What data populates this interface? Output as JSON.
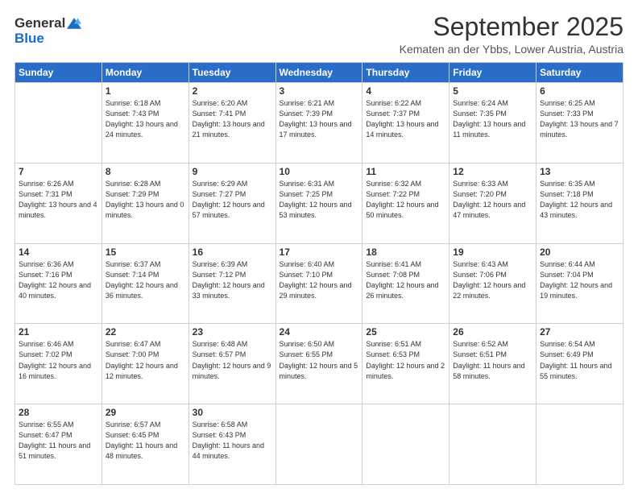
{
  "header": {
    "logo_general": "General",
    "logo_blue": "Blue",
    "month": "September 2025",
    "location": "Kematen an der Ybbs, Lower Austria, Austria"
  },
  "weekdays": [
    "Sunday",
    "Monday",
    "Tuesday",
    "Wednesday",
    "Thursday",
    "Friday",
    "Saturday"
  ],
  "weeks": [
    [
      {
        "day": "",
        "sunrise": "",
        "sunset": "",
        "daylight": ""
      },
      {
        "day": "1",
        "sunrise": "Sunrise: 6:18 AM",
        "sunset": "Sunset: 7:43 PM",
        "daylight": "Daylight: 13 hours and 24 minutes."
      },
      {
        "day": "2",
        "sunrise": "Sunrise: 6:20 AM",
        "sunset": "Sunset: 7:41 PM",
        "daylight": "Daylight: 13 hours and 21 minutes."
      },
      {
        "day": "3",
        "sunrise": "Sunrise: 6:21 AM",
        "sunset": "Sunset: 7:39 PM",
        "daylight": "Daylight: 13 hours and 17 minutes."
      },
      {
        "day": "4",
        "sunrise": "Sunrise: 6:22 AM",
        "sunset": "Sunset: 7:37 PM",
        "daylight": "Daylight: 13 hours and 14 minutes."
      },
      {
        "day": "5",
        "sunrise": "Sunrise: 6:24 AM",
        "sunset": "Sunset: 7:35 PM",
        "daylight": "Daylight: 13 hours and 11 minutes."
      },
      {
        "day": "6",
        "sunrise": "Sunrise: 6:25 AM",
        "sunset": "Sunset: 7:33 PM",
        "daylight": "Daylight: 13 hours and 7 minutes."
      }
    ],
    [
      {
        "day": "7",
        "sunrise": "Sunrise: 6:26 AM",
        "sunset": "Sunset: 7:31 PM",
        "daylight": "Daylight: 13 hours and 4 minutes."
      },
      {
        "day": "8",
        "sunrise": "Sunrise: 6:28 AM",
        "sunset": "Sunset: 7:29 PM",
        "daylight": "Daylight: 13 hours and 0 minutes."
      },
      {
        "day": "9",
        "sunrise": "Sunrise: 6:29 AM",
        "sunset": "Sunset: 7:27 PM",
        "daylight": "Daylight: 12 hours and 57 minutes."
      },
      {
        "day": "10",
        "sunrise": "Sunrise: 6:31 AM",
        "sunset": "Sunset: 7:25 PM",
        "daylight": "Daylight: 12 hours and 53 minutes."
      },
      {
        "day": "11",
        "sunrise": "Sunrise: 6:32 AM",
        "sunset": "Sunset: 7:22 PM",
        "daylight": "Daylight: 12 hours and 50 minutes."
      },
      {
        "day": "12",
        "sunrise": "Sunrise: 6:33 AM",
        "sunset": "Sunset: 7:20 PM",
        "daylight": "Daylight: 12 hours and 47 minutes."
      },
      {
        "day": "13",
        "sunrise": "Sunrise: 6:35 AM",
        "sunset": "Sunset: 7:18 PM",
        "daylight": "Daylight: 12 hours and 43 minutes."
      }
    ],
    [
      {
        "day": "14",
        "sunrise": "Sunrise: 6:36 AM",
        "sunset": "Sunset: 7:16 PM",
        "daylight": "Daylight: 12 hours and 40 minutes."
      },
      {
        "day": "15",
        "sunrise": "Sunrise: 6:37 AM",
        "sunset": "Sunset: 7:14 PM",
        "daylight": "Daylight: 12 hours and 36 minutes."
      },
      {
        "day": "16",
        "sunrise": "Sunrise: 6:39 AM",
        "sunset": "Sunset: 7:12 PM",
        "daylight": "Daylight: 12 hours and 33 minutes."
      },
      {
        "day": "17",
        "sunrise": "Sunrise: 6:40 AM",
        "sunset": "Sunset: 7:10 PM",
        "daylight": "Daylight: 12 hours and 29 minutes."
      },
      {
        "day": "18",
        "sunrise": "Sunrise: 6:41 AM",
        "sunset": "Sunset: 7:08 PM",
        "daylight": "Daylight: 12 hours and 26 minutes."
      },
      {
        "day": "19",
        "sunrise": "Sunrise: 6:43 AM",
        "sunset": "Sunset: 7:06 PM",
        "daylight": "Daylight: 12 hours and 22 minutes."
      },
      {
        "day": "20",
        "sunrise": "Sunrise: 6:44 AM",
        "sunset": "Sunset: 7:04 PM",
        "daylight": "Daylight: 12 hours and 19 minutes."
      }
    ],
    [
      {
        "day": "21",
        "sunrise": "Sunrise: 6:46 AM",
        "sunset": "Sunset: 7:02 PM",
        "daylight": "Daylight: 12 hours and 16 minutes."
      },
      {
        "day": "22",
        "sunrise": "Sunrise: 6:47 AM",
        "sunset": "Sunset: 7:00 PM",
        "daylight": "Daylight: 12 hours and 12 minutes."
      },
      {
        "day": "23",
        "sunrise": "Sunrise: 6:48 AM",
        "sunset": "Sunset: 6:57 PM",
        "daylight": "Daylight: 12 hours and 9 minutes."
      },
      {
        "day": "24",
        "sunrise": "Sunrise: 6:50 AM",
        "sunset": "Sunset: 6:55 PM",
        "daylight": "Daylight: 12 hours and 5 minutes."
      },
      {
        "day": "25",
        "sunrise": "Sunrise: 6:51 AM",
        "sunset": "Sunset: 6:53 PM",
        "daylight": "Daylight: 12 hours and 2 minutes."
      },
      {
        "day": "26",
        "sunrise": "Sunrise: 6:52 AM",
        "sunset": "Sunset: 6:51 PM",
        "daylight": "Daylight: 11 hours and 58 minutes."
      },
      {
        "day": "27",
        "sunrise": "Sunrise: 6:54 AM",
        "sunset": "Sunset: 6:49 PM",
        "daylight": "Daylight: 11 hours and 55 minutes."
      }
    ],
    [
      {
        "day": "28",
        "sunrise": "Sunrise: 6:55 AM",
        "sunset": "Sunset: 6:47 PM",
        "daylight": "Daylight: 11 hours and 51 minutes."
      },
      {
        "day": "29",
        "sunrise": "Sunrise: 6:57 AM",
        "sunset": "Sunset: 6:45 PM",
        "daylight": "Daylight: 11 hours and 48 minutes."
      },
      {
        "day": "30",
        "sunrise": "Sunrise: 6:58 AM",
        "sunset": "Sunset: 6:43 PM",
        "daylight": "Daylight: 11 hours and 44 minutes."
      },
      {
        "day": "",
        "sunrise": "",
        "sunset": "",
        "daylight": ""
      },
      {
        "day": "",
        "sunrise": "",
        "sunset": "",
        "daylight": ""
      },
      {
        "day": "",
        "sunrise": "",
        "sunset": "",
        "daylight": ""
      },
      {
        "day": "",
        "sunrise": "",
        "sunset": "",
        "daylight": ""
      }
    ]
  ]
}
